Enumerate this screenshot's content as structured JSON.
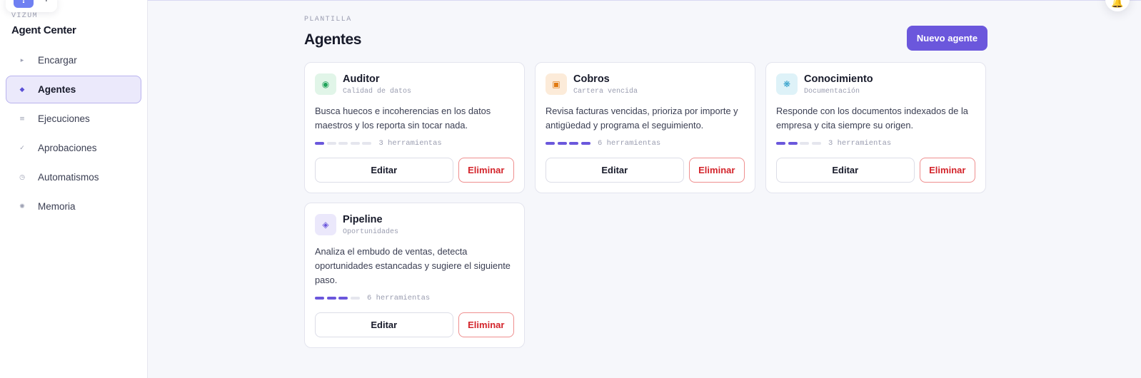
{
  "top_widget": {
    "alert_glyph": "!",
    "plus_glyph": "+",
    "icons": [
      "alert-icon",
      "plus-icon"
    ]
  },
  "sidebar": {
    "kicker": "VIZUM",
    "title": "Agent Center",
    "items": [
      {
        "label": "Encargar",
        "icon": "play-icon",
        "glyph": "▸",
        "active": false
      },
      {
        "label": "Agentes",
        "icon": "diamond-icon",
        "glyph": "◆",
        "active": true
      },
      {
        "label": "Ejecuciones",
        "icon": "list-icon",
        "glyph": "≡",
        "active": false
      },
      {
        "label": "Aprobaciones",
        "icon": "check-icon",
        "glyph": "✓",
        "active": false
      },
      {
        "label": "Automatismos",
        "icon": "clock-icon",
        "glyph": "◷",
        "active": false
      },
      {
        "label": "Memoria",
        "icon": "sparkle-icon",
        "glyph": "✺",
        "active": false
      }
    ]
  },
  "header": {
    "kicker": "PLANTILLA",
    "title": "Agentes",
    "new_button": "Nuevo agente",
    "bell_icon": "bell-icon",
    "bell_glyph": "🔔"
  },
  "agents": [
    {
      "name": "Auditor",
      "subtitle": "Calidad de datos",
      "description": "Busca huecos e incoherencias en los datos maestros y los reporta sin tocar nada.",
      "tools_label": "3 herramientas",
      "tools_level": 1,
      "tools_max": 5,
      "icon": "target-icon",
      "glyph": "◉",
      "icon_color": "#21a35a",
      "icon_bg": "#e1f5e8",
      "edit_label": "Editar",
      "delete_label": "Eliminar"
    },
    {
      "name": "Cobros",
      "subtitle": "Cartera vencida",
      "description": "Revisa facturas vencidas, prioriza por importe y antigüedad y programa el seguimiento.",
      "tools_label": "6 herramientas",
      "tools_level": 4,
      "tools_max": 4,
      "icon": "invoice-icon",
      "glyph": "▣",
      "icon_color": "#e07a12",
      "icon_bg": "#fcebd9",
      "edit_label": "Editar",
      "delete_label": "Eliminar"
    },
    {
      "name": "Conocimiento",
      "subtitle": "Documentación",
      "description": "Responde con los documentos indexados de la empresa y cita siempre su origen.",
      "tools_label": "3 herramientas",
      "tools_level": 2,
      "tools_max": 4,
      "icon": "knowledge-icon",
      "glyph": "❋",
      "icon_color": "#2a9cc8",
      "icon_bg": "#def2f8",
      "edit_label": "Editar",
      "delete_label": "Eliminar"
    },
    {
      "name": "Pipeline",
      "subtitle": "Oportunidades",
      "description": "Analiza el embudo de ventas, detecta oportunidades estancadas y sugiere el siguiente paso.",
      "tools_label": "6 herramientas",
      "tools_level": 3,
      "tools_max": 4,
      "icon": "funnel-icon",
      "glyph": "◈",
      "icon_color": "#6b57dc",
      "icon_bg": "#ebe8fb",
      "edit_label": "Editar",
      "delete_label": "Eliminar"
    }
  ]
}
